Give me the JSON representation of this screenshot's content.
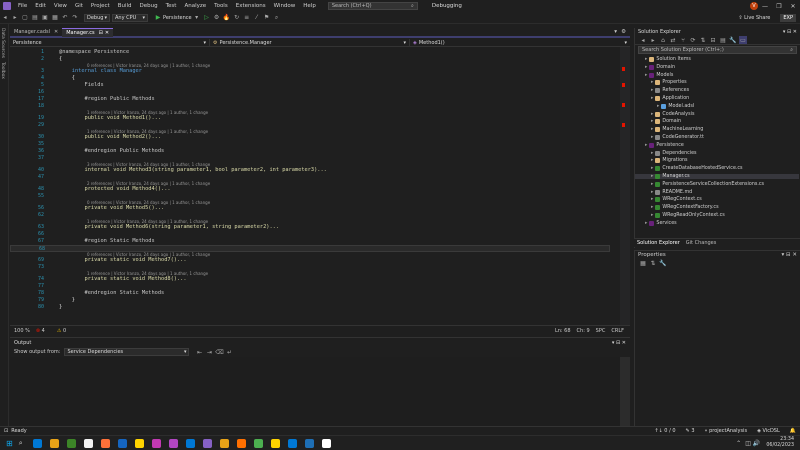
{
  "menubar": {
    "items": [
      "File",
      "Edit",
      "View",
      "Git",
      "Project",
      "Build",
      "Debug",
      "Test",
      "Analyze",
      "Tools",
      "Extensions",
      "Window",
      "Help"
    ],
    "search_placeholder": "Search (Ctrl+Q)",
    "window_title": "Debugging",
    "avatar": "V",
    "live_share": "Live Share",
    "exp_badge": "EXP"
  },
  "toolbar": {
    "config": "Debug",
    "platform": "Any CPU",
    "run_target": "Persistence"
  },
  "leftstrip": {
    "items": [
      "Data Sources",
      "Toolbox"
    ]
  },
  "doctabs": [
    {
      "label": "Manager.cadsl",
      "active": false
    },
    {
      "label": "Manager.cs",
      "active": true
    }
  ],
  "navbar": {
    "project": "Persistence",
    "class": "Persistence.Manager",
    "member": "Method1()"
  },
  "editor": {
    "lines": [
      {
        "n": "1",
        "text": "@namespace Persistence",
        "cls": "rg"
      },
      {
        "n": "2",
        "text": "{"
      },
      {
        "lens": "0 references | Victor Iranzo, 24 days ago | 1 author, 1 change"
      },
      {
        "n": "3",
        "text": "    internal class Manager",
        "cls": "kw"
      },
      {
        "n": "4",
        "text": "    {"
      },
      {
        "n": "5",
        "text": "        Fields",
        "cls": "rg"
      },
      {
        "n": "16",
        "text": ""
      },
      {
        "n": "17",
        "text": "        #region Public Methods",
        "cls": "rg"
      },
      {
        "n": "18",
        "text": ""
      },
      {
        "lens": "1 reference | Victor Iranzo, 24 days ago | 1 author, 1 change"
      },
      {
        "n": "19",
        "text": "        public void Method1()...",
        "cls": "mt"
      },
      {
        "n": "29",
        "text": ""
      },
      {
        "lens": "1 reference | Victor Iranzo, 24 days ago | 1 author, 1 change"
      },
      {
        "n": "30",
        "text": "        public void Method2()...",
        "cls": "mt"
      },
      {
        "n": "35",
        "text": ""
      },
      {
        "n": "36",
        "text": "        #endregion Public Methods",
        "cls": "rg"
      },
      {
        "n": "37",
        "text": ""
      },
      {
        "lens": "3 references | Victor Iranzo, 24 days ago | 1 author, 1 change"
      },
      {
        "n": "40",
        "text": "        internal void Method3(string parameter1, bool parameter2, int parameter3)...",
        "cls": "mt"
      },
      {
        "n": "47",
        "text": ""
      },
      {
        "lens": "2 references | Victor Iranzo, 24 days ago | 1 author, 1 change"
      },
      {
        "n": "48",
        "text": "        protected void Method4()...",
        "cls": "mt"
      },
      {
        "n": "55",
        "text": ""
      },
      {
        "lens": "0 references | Victor Iranzo, 24 days ago | 1 author, 1 change"
      },
      {
        "n": "56",
        "text": "        private void Method5()...",
        "cls": "mt"
      },
      {
        "n": "62",
        "text": ""
      },
      {
        "lens": "1 reference | Victor Iranzo, 24 days ago | 1 author, 1 change"
      },
      {
        "n": "63",
        "text": "        private void Method6(string parameter1, string parameter2)...",
        "cls": "mt"
      },
      {
        "n": "66",
        "text": ""
      },
      {
        "n": "67",
        "text": "        #region Static Methods",
        "cls": "rg"
      },
      {
        "n": "68",
        "text": "",
        "hl": true
      },
      {
        "lens": "0 references | Victor Iranzo, 24 days ago | 1 author, 1 change"
      },
      {
        "n": "69",
        "text": "        private static void Method7()...",
        "cls": "mt"
      },
      {
        "n": "73",
        "text": ""
      },
      {
        "lens": "1 reference | Victor Iranzo, 24 days ago | 1 author, 1 change"
      },
      {
        "n": "74",
        "text": "        private static void Method8()...",
        "cls": "mt"
      },
      {
        "n": "77",
        "text": ""
      },
      {
        "n": "78",
        "text": "        #endregion Static Methods",
        "cls": "rg"
      },
      {
        "n": "79",
        "text": "    }"
      },
      {
        "n": "80",
        "text": "}"
      }
    ]
  },
  "edstatus": {
    "zoom": "100 %",
    "errors": "4",
    "warnings": "0",
    "position": "Ln: 68",
    "column": "Ch: 9",
    "whitespace": "SPC",
    "line_ending": "CRLF"
  },
  "output": {
    "title": "Output",
    "show_from_label": "Show output from:",
    "show_from_value": "Service Dependencies"
  },
  "solution": {
    "title": "Solution Explorer",
    "search_placeholder": "Search Solution Explorer (Ctrl+;)",
    "items": [
      {
        "label": "Solution Items",
        "depth": 1,
        "color": "#dcb67a"
      },
      {
        "label": "Domain",
        "depth": 1,
        "color": "#68217a"
      },
      {
        "label": "Models",
        "depth": 1,
        "color": "#68217a"
      },
      {
        "label": "Properties",
        "depth": 2,
        "color": "#dcb67a"
      },
      {
        "label": "References",
        "depth": 2,
        "color": "#888888"
      },
      {
        "label": "Application",
        "depth": 2,
        "color": "#dcb67a"
      },
      {
        "label": "Model.adsl",
        "depth": 3,
        "color": "#5aa0e0"
      },
      {
        "label": "CodeAnalysis",
        "depth": 2,
        "color": "#dcb67a"
      },
      {
        "label": "Domain",
        "depth": 2,
        "color": "#dcb67a"
      },
      {
        "label": "MachineLearning",
        "depth": 2,
        "color": "#dcb67a"
      },
      {
        "label": "CodeGenerator.tt",
        "depth": 2,
        "color": "#888888"
      },
      {
        "label": "Persistence",
        "depth": 1,
        "color": "#68217a"
      },
      {
        "label": "Dependencies",
        "depth": 2,
        "color": "#888888"
      },
      {
        "label": "Migrations",
        "depth": 2,
        "color": "#dcb67a"
      },
      {
        "label": "CreateDatabaseHostedService.cs",
        "depth": 2,
        "color": "#368832"
      },
      {
        "label": "Manager.cs",
        "depth": 2,
        "color": "#368832",
        "selected": true
      },
      {
        "label": "PersistenceServiceCollectionExtensions.cs",
        "depth": 2,
        "color": "#368832"
      },
      {
        "label": "README.md",
        "depth": 2,
        "color": "#888888"
      },
      {
        "label": "WRegContext.cs",
        "depth": 2,
        "color": "#368832"
      },
      {
        "label": "WRegContextFactory.cs",
        "depth": 2,
        "color": "#368832"
      },
      {
        "label": "WRegReadOnlyContext.cs",
        "depth": 2,
        "color": "#368832"
      },
      {
        "label": "Services",
        "depth": 1,
        "color": "#68217a"
      }
    ],
    "tabs": [
      "Solution Explorer",
      "Git Changes"
    ]
  },
  "properties": {
    "title": "Properties"
  },
  "statusbar": {
    "ready": "Ready",
    "git_up": "0 / 0",
    "pencil": "3",
    "branch": "projectAnalysis",
    "repo": "VicDSL"
  },
  "taskbar": {
    "time": "23:34",
    "date": "06/02/2023",
    "apps": [
      "#0078d4",
      "#e8a317",
      "#3c8527",
      "#f3f3f3",
      "#ff7139",
      "#1565c0",
      "#ffd400",
      "#c239b3",
      "#b146c2",
      "#0078d4",
      "#8661c5",
      "#e8a317",
      "#ff6f00",
      "#4caf50",
      "#ffd400",
      "#0078d4",
      "#1e6fb5",
      "#ffffff"
    ]
  }
}
